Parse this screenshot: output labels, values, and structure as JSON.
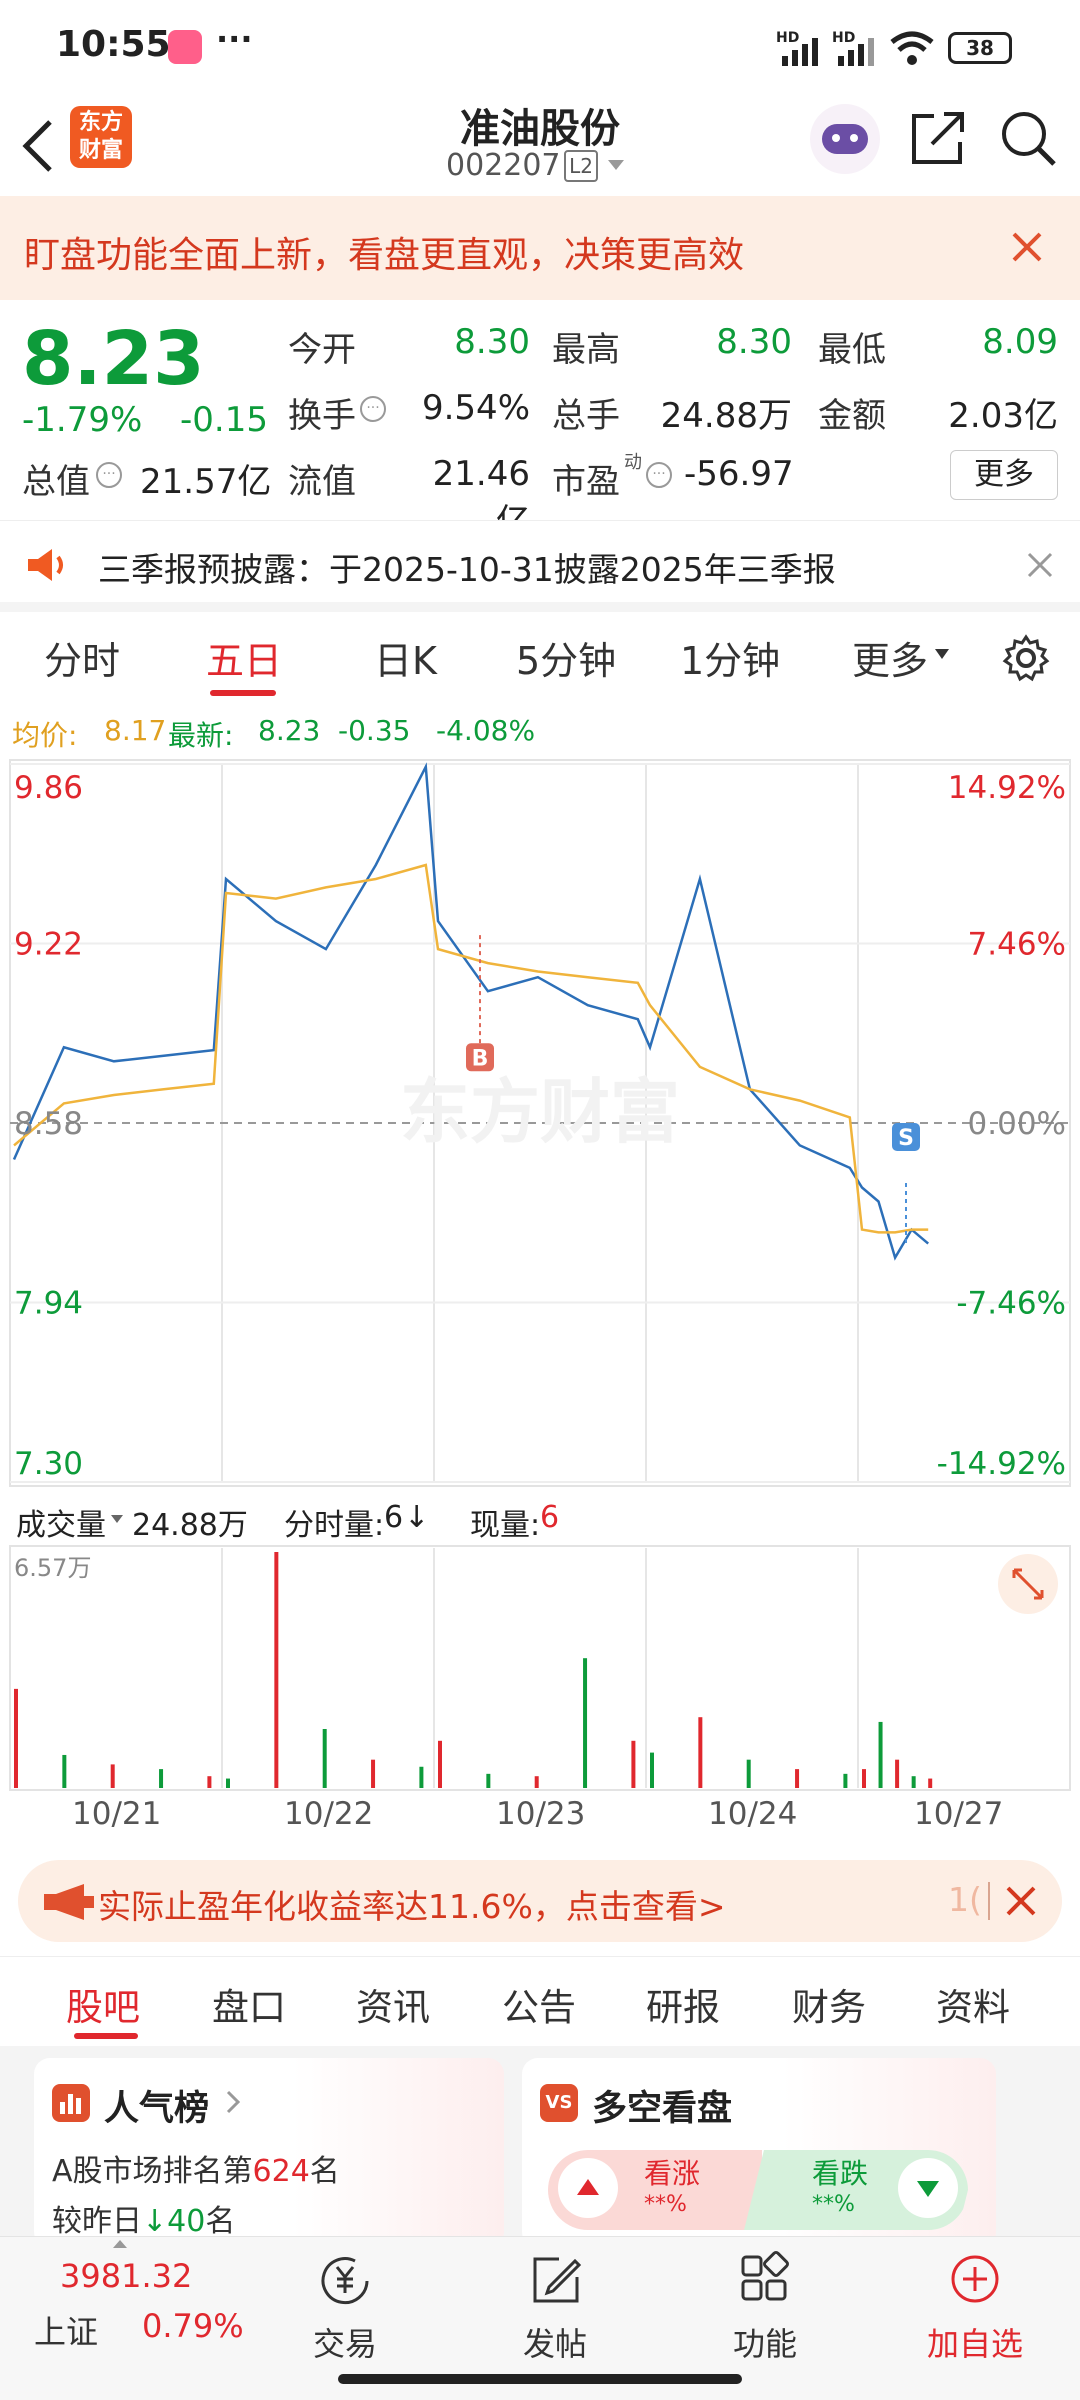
{
  "status_bar": {
    "time": "10:55",
    "more": "···",
    "network1": "HD",
    "network2": "HD",
    "battery": "38"
  },
  "nav": {
    "logo_line1": "东方",
    "logo_line2": "财富",
    "title": "准油股份",
    "code": "002207",
    "level_badge": "L2"
  },
  "banner": {
    "text": "盯盘功能全面上新，看盘更直观，决策更高效"
  },
  "quote": {
    "price": "8.23",
    "change_pct": "-1.79%",
    "change": "-0.15",
    "fields": [
      {
        "label": "今开",
        "value": "8.30",
        "color": "green"
      },
      {
        "label": "最高",
        "value": "8.30",
        "color": "green"
      },
      {
        "label": "最低",
        "value": "8.09",
        "color": "green"
      },
      {
        "label": "换手",
        "value": "9.54%",
        "color": "black"
      },
      {
        "label": "总手",
        "value": "24.88万",
        "color": "black"
      },
      {
        "label": "金额",
        "value": "2.03亿",
        "color": "black"
      },
      {
        "label": "总值",
        "value": "21.57亿",
        "color": "black"
      },
      {
        "label": "流值",
        "value": "21.46亿",
        "color": "black"
      },
      {
        "label": "市盈",
        "value": "-56.97",
        "color": "black"
      }
    ],
    "pe_superscript": "动",
    "more_button": "更多"
  },
  "notice": {
    "text": "三季报预披露：于2025-10-31披露2025年三季报"
  },
  "tabs": [
    "分时",
    "五日",
    "日K",
    "5分钟",
    "1分钟",
    "更多"
  ],
  "active_tab": "五日",
  "chart_header": {
    "avg_label": "均价:",
    "avg_value": "8.17",
    "latest_label": "最新:",
    "latest_value": "8.23",
    "latest_change": "-0.35",
    "latest_pct": "-4.08%"
  },
  "chart_data": {
    "type": "line",
    "y_left_ticks": [
      "9.86",
      "9.22",
      "8.58",
      "7.94",
      "7.30"
    ],
    "y_right_ticks": [
      "14.92%",
      "7.46%",
      "0.00%",
      "-7.46%",
      "-14.92%"
    ],
    "ylim": [
      7.3,
      9.86
    ],
    "baseline": 8.58,
    "x_labels": [
      "10/21",
      "10/22",
      "10/23",
      "10/24",
      "10/27"
    ],
    "markers": [
      {
        "label": "B",
        "day": 3
      },
      {
        "label": "S",
        "day": 5
      }
    ],
    "series": [
      {
        "name": "price",
        "values": [
          8.45,
          8.85,
          8.8,
          8.82,
          8.84,
          9.45,
          9.3,
          9.2,
          9.5,
          9.85,
          9.3,
          9.05,
          9.1,
          9.0,
          8.95,
          8.85,
          9.45,
          8.7,
          8.5,
          8.42,
          8.35,
          8.3,
          8.1,
          8.2,
          8.15
        ]
      },
      {
        "name": "avg",
        "values": [
          8.5,
          8.65,
          8.68,
          8.7,
          8.72,
          9.4,
          9.38,
          9.42,
          9.45,
          9.5,
          9.2,
          9.15,
          9.12,
          9.1,
          9.08,
          9.0,
          8.78,
          8.7,
          8.66,
          8.6,
          8.2,
          8.19,
          8.19,
          8.2,
          8.2
        ]
      }
    ]
  },
  "volume": {
    "label": "成交量",
    "total": "24.88万",
    "fenshi_label": "分时量:",
    "fenshi_value": "6",
    "arrow": "↓",
    "now_label": "现量:",
    "now_value": "6",
    "max_label": "6.57万",
    "bars": [
      0.42,
      0.14,
      0.1,
      0.08,
      0.05,
      0.04,
      1.0,
      0.25,
      0.12,
      0.09,
      0.2,
      0.06,
      0.05,
      0.55,
      0.2,
      0.15,
      0.3,
      0.12,
      0.08,
      0.06,
      0.08,
      0.28,
      0.12,
      0.05,
      0.04
    ]
  },
  "promo": {
    "text": "实际止盈年化收益率达11.6%，点击查看>",
    "counter": "1("
  },
  "sub_tabs": [
    "股吧",
    "盘口",
    "资讯",
    "公告",
    "研报",
    "财务",
    "资料"
  ],
  "active_sub_tab": "股吧",
  "popularity": {
    "title": "人气榜",
    "line1_prefix": "A股市场排名第",
    "rank": "624",
    "line1_suffix": "名",
    "line2_prefix": "较昨日",
    "delta": "40",
    "line2_suffix": "名"
  },
  "bullbear": {
    "badge": "VS",
    "title": "多空看盘",
    "up_label": "看涨",
    "up_value": "**%",
    "down_label": "看跌",
    "down_value": "**%"
  },
  "bottom_bar": {
    "index_value": "3981.32",
    "index_name": "上证",
    "index_pct": "0.79%",
    "tabs": [
      "交易",
      "发帖",
      "功能",
      "加自选"
    ]
  },
  "colors": {
    "red": "#e0282e",
    "green": "#0d9b3a",
    "avg_line": "#f0b43c",
    "price_line": "#2c6fb8",
    "banner_bg": "#fdeee4"
  }
}
